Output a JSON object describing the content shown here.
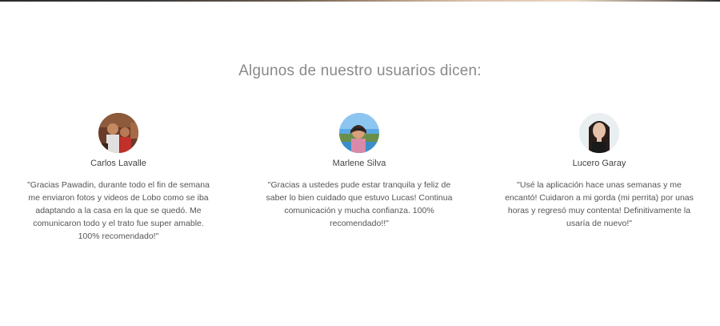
{
  "section": {
    "title": "Algunos de nuestro usuarios dicen:"
  },
  "testimonials": [
    {
      "name": "Carlos Lavalle",
      "avatar_icon": "user-photo-carlos",
      "quote": "\"Gracias Pawadin, durante todo el fin de semana me enviaron fotos y videos de Lobo como se iba adaptando a la casa en la que se quedó. Me comunicaron todo y el trato fue super amable. 100% recomendado!\""
    },
    {
      "name": "Marlene Silva",
      "avatar_icon": "user-photo-marlene",
      "quote": "\"Gracias a ustedes pude estar tranquila y feliz de saber lo bien cuidado que estuvo Lucas! Continua comunicación y mucha confianza. 100% recomendado!!\""
    },
    {
      "name": "Lucero Garay",
      "avatar_icon": "user-photo-lucero",
      "quote": "\"Usé la aplicación hace unas semanas y me encantó! Cuidaron a mi gorda (mi perrita) por unas horas y regresó muy contenta! Definitivamente la usaría de nuevo!\""
    }
  ]
}
